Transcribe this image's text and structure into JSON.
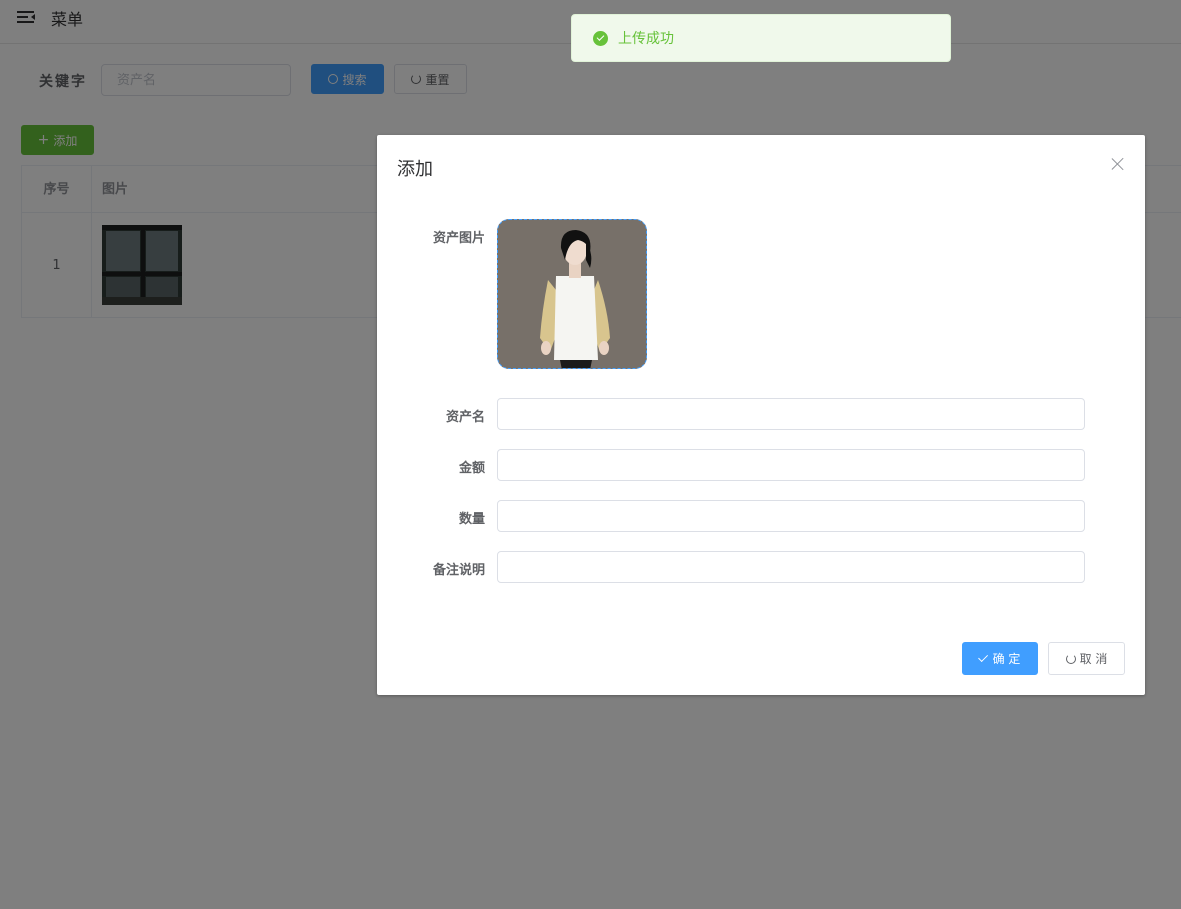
{
  "topbar": {
    "title": "菜单",
    "menu_icon": "menu-fold-icon"
  },
  "search": {
    "label": "关键字",
    "placeholder": "资产名",
    "search_label": "搜索",
    "reset_label": "重置"
  },
  "toolbar": {
    "add_label": "添加"
  },
  "table": {
    "columns": [
      "序号",
      "图片"
    ],
    "rows": [
      {
        "index": "1"
      }
    ]
  },
  "dialog": {
    "title": "添加",
    "fields": {
      "image_label": "资产图片",
      "name_label": "资产名",
      "amount_label": "金额",
      "quantity_label": "数量",
      "remark_label": "备注说明"
    },
    "confirm_label": "确 定",
    "cancel_label": "取 消"
  },
  "toast": {
    "message": "上传成功",
    "type": "success"
  },
  "colors": {
    "primary": "#409eff",
    "success": "#67c23a",
    "overlay": "rgba(0,0,0,0.5)"
  }
}
